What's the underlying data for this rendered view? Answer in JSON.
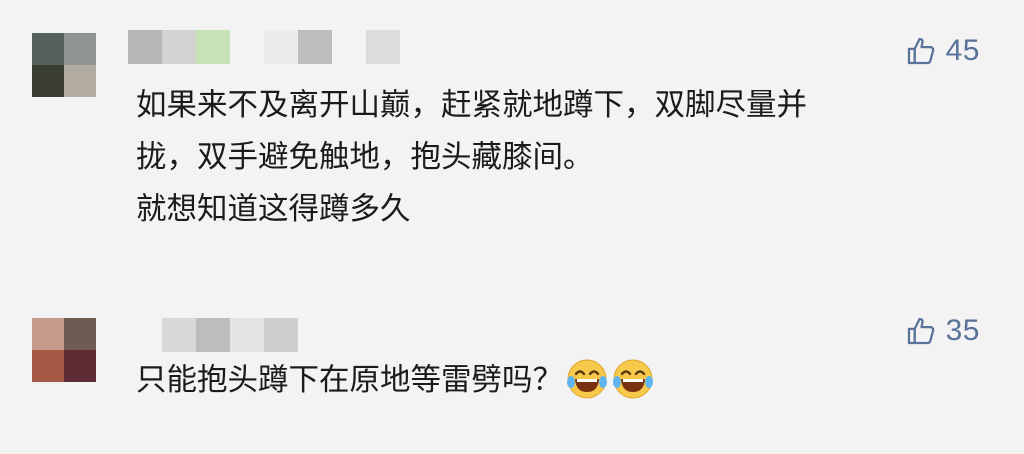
{
  "comments": [
    {
      "likes": "45",
      "lines": [
        "如果来不及离开山巅，赶紧就地蹲下，双脚尽量并",
        "拢，双手避免触地，抱头藏膝间。",
        "就想知道这得蹲多久"
      ],
      "avatar_colors": [
        "#56615f",
        "#8f9694",
        "#3a3d31",
        "#b1aba0"
      ],
      "name_blur_colors": [
        "#b7b7b7",
        "#d3d3d3",
        "#c6e3b5",
        "#f3f3f3",
        "#ebebeb",
        "#bdbdbd",
        "#f3f3f3",
        "#dcdcdc"
      ]
    },
    {
      "likes": "35",
      "text": "只能抱头蹲下在原地等雷劈吗？",
      "emojis": [
        "laughing-crying-emoji",
        "laughing-crying-emoji"
      ],
      "avatar_colors": [
        "#c79a8e",
        "#6f5b52",
        "#a45a45",
        "#5e2c34"
      ],
      "name_blur_colors": [
        "#f3f3f3",
        "#d8d8d8",
        "#bdbdbd",
        "#e4e4e4",
        "#cfcfcf"
      ]
    }
  ],
  "colors": {
    "background": "#f3f3f3",
    "like": "#59739a",
    "text": "#1b1b1b",
    "emoji_face": "#f7c94a"
  }
}
